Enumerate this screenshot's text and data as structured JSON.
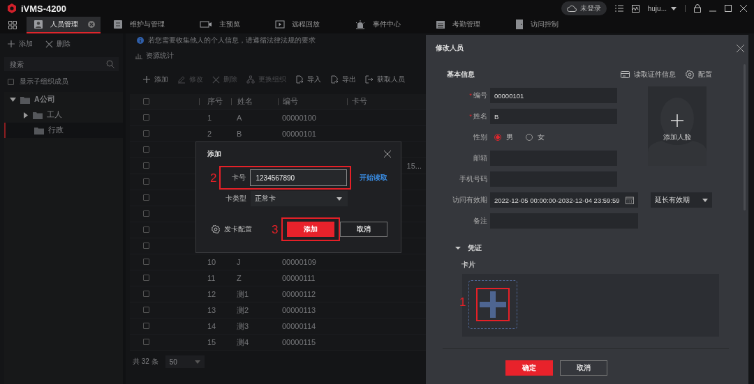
{
  "title_bar": {
    "app_name": "iVMS-4200",
    "cloud_status": "未登录",
    "user": "huju..."
  },
  "tabs": [
    {
      "label": "人员管理",
      "kind": "person",
      "selected": true,
      "closable": true
    },
    {
      "label": "维护与管理",
      "kind": "panel",
      "selected": false,
      "closable": false
    },
    {
      "label": "主预览",
      "kind": "camera",
      "selected": false,
      "closable": false
    },
    {
      "label": "远程回放",
      "kind": "play",
      "selected": false,
      "closable": false
    },
    {
      "label": "事件中心",
      "kind": "alarm",
      "selected": false,
      "closable": false
    },
    {
      "label": "考勤管理",
      "kind": "calendar",
      "selected": false,
      "closable": false
    },
    {
      "label": "访问控制",
      "kind": "door",
      "selected": false,
      "closable": false
    }
  ],
  "sidebar": {
    "actions": [
      {
        "label": "添加",
        "kind": "plus"
      },
      {
        "label": "删除",
        "kind": "cross"
      }
    ],
    "search": {
      "placeholder": "搜索"
    },
    "show_sub_org": {
      "label": "显示子组织成员",
      "checked": false
    },
    "tree": [
      {
        "label": "A公司",
        "expanded": true,
        "selected": false,
        "children": [
          {
            "label": "工人",
            "expanded": false,
            "selected": false
          },
          {
            "label": "行政",
            "selected": true
          }
        ]
      }
    ]
  },
  "notice": "若您需要收集他人的个人信息，请遵循法律法规的要求",
  "stats_link": "资源统计",
  "toolbar": [
    {
      "label": "添加",
      "kind": "plus",
      "disabled": false
    },
    {
      "label": "修改",
      "kind": "edit",
      "disabled": true
    },
    {
      "label": "删除",
      "kind": "cross",
      "disabled": true
    },
    {
      "label": "更换组织",
      "kind": "org",
      "disabled": true
    },
    {
      "label": "导入",
      "kind": "import",
      "disabled": false
    },
    {
      "label": "导出",
      "kind": "export",
      "disabled": false
    },
    {
      "label": "获取人员",
      "kind": "fetch",
      "disabled": false
    }
  ],
  "table": {
    "select_all_checked": false,
    "columns": [
      "序号",
      "姓名",
      "编号",
      "卡号"
    ],
    "rows": [
      {
        "checked": false,
        "seq": "1",
        "name": "A",
        "code": "00000100"
      },
      {
        "checked": false,
        "seq": "2",
        "name": "B",
        "code": "00000101"
      },
      {
        "checked": false
      },
      {
        "checked": false,
        "card": "15..."
      },
      {
        "checked": false
      },
      {
        "checked": false
      },
      {
        "checked": false
      },
      {
        "checked": false
      },
      {
        "checked": false
      },
      {
        "checked": false,
        "seq": "10",
        "name": "J",
        "code": "00000109"
      },
      {
        "checked": false,
        "seq": "11",
        "name": "Z",
        "code": "00000111"
      },
      {
        "checked": false,
        "seq": "12",
        "name": "测1",
        "code": "00000112"
      },
      {
        "checked": false,
        "seq": "13",
        "name": "测2",
        "code": "00000113"
      },
      {
        "checked": false,
        "seq": "14",
        "name": "测3",
        "code": "00000114"
      },
      {
        "checked": false,
        "seq": "15",
        "name": "测4",
        "code": "00000115"
      }
    ]
  },
  "footer": {
    "total": "共 32 条",
    "page_size": "50"
  },
  "add_card_dialog": {
    "title": "添加",
    "card_no": {
      "label": "卡号",
      "value": "1234567890",
      "annotation": "2"
    },
    "read_link": "开始读取",
    "card_type": {
      "label": "卡类型",
      "value": "正常卡"
    },
    "config": "发卡配置",
    "add_button": {
      "label": "添加",
      "annotation": "3"
    },
    "cancel_button": "取消"
  },
  "edit_person_panel": {
    "title": "修改人员",
    "section": "基本信息",
    "read_id": "读取证件信息",
    "config": "配置",
    "fields": [
      {
        "kind": "text",
        "label": "编号",
        "required_mark": "*",
        "value": "00000101"
      },
      {
        "kind": "text",
        "label": "姓名",
        "required_mark": "*",
        "value": "B"
      },
      {
        "kind": "radio",
        "label": "性别",
        "options": [
          {
            "label": "男",
            "selected": true
          },
          {
            "label": "女",
            "selected": false
          }
        ]
      },
      {
        "kind": "text",
        "label": "邮箱"
      },
      {
        "kind": "text",
        "label": "手机号码"
      }
    ],
    "face": "添加人脸",
    "validity": {
      "label": "访问有效期",
      "value": "2022-12-05 00:00:00-2032-12-04 23:59:59",
      "extend": "延长有效期"
    },
    "remark": {
      "label": "备注"
    },
    "credentials": {
      "title": "凭证",
      "expanded": true,
      "card_label": "卡片",
      "annotation": "1"
    },
    "ok_button": "确定",
    "cancel_button": "取消"
  }
}
